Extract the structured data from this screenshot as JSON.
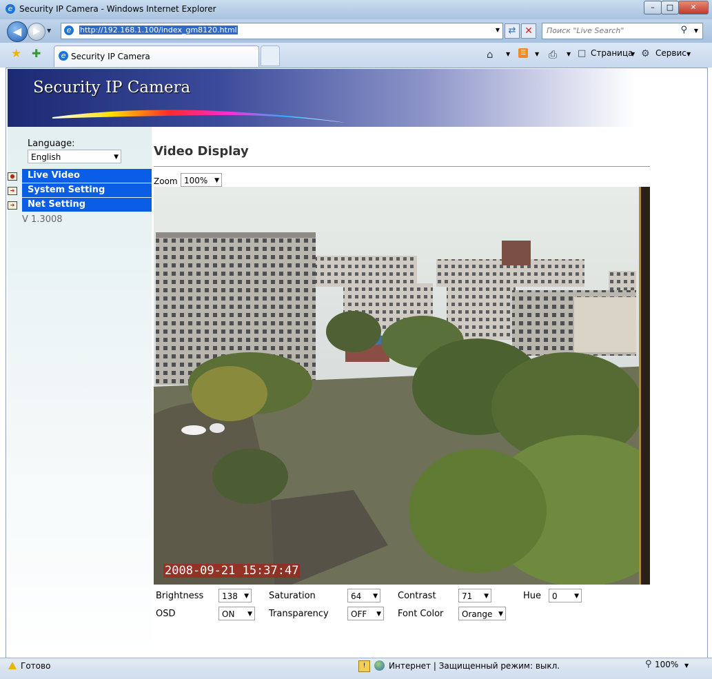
{
  "window": {
    "title": "Security IP Camera - Windows Internet Explorer",
    "minimize": "–",
    "maximize": "□",
    "close": "✕"
  },
  "browser": {
    "url": "http://192.168.1.100/index_gm8120.html",
    "search_placeholder": "Поиск \"Live Search\"",
    "tab_title": "Security IP Camera",
    "page_menu": "Страница",
    "tools_menu": "Сервис",
    "status": "Готово",
    "zone": "Интернет | Защищенный режим: выкл.",
    "zoom": "100%"
  },
  "banner": {
    "title": "Security IP Camera"
  },
  "sidebar": {
    "language_label": "Language:",
    "language_value": "English",
    "items": [
      {
        "label": "Live Video"
      },
      {
        "label": "System Setting"
      },
      {
        "label": "Net Setting"
      }
    ],
    "version": "V 1.3008"
  },
  "main": {
    "title": "Video Display",
    "zoom_label": "Zoom",
    "zoom_value": "100%",
    "timestamp": "2008-09-21 15:37:47"
  },
  "controls": {
    "brightness_label": "Brightness",
    "brightness_value": "138",
    "saturation_label": "Saturation",
    "saturation_value": "64",
    "contrast_label": "Contrast",
    "contrast_value": "71",
    "hue_label": "Hue",
    "hue_value": "0",
    "osd_label": "OSD",
    "osd_value": "ON",
    "transparency_label": "Transparency",
    "transparency_value": "OFF",
    "fontcolor_label": "Font Color",
    "fontcolor_value": "Orange"
  }
}
